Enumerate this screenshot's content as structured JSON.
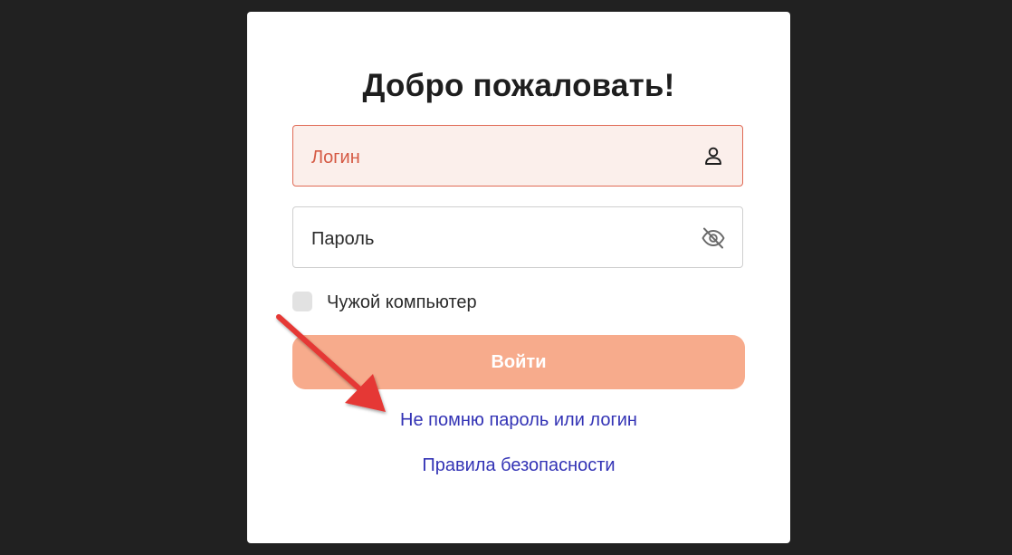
{
  "card": {
    "title": "Добро пожаловать!"
  },
  "login_field": {
    "label": "Логин",
    "icon": "user-icon",
    "state": "error",
    "accent_color": "#e06a55"
  },
  "password_field": {
    "label": "Пароль",
    "icon": "eye-off-icon"
  },
  "foreign_computer": {
    "label": "Чужой компьютер",
    "checked": false
  },
  "submit_button": {
    "label": "Войти",
    "color": "#f7ab8c"
  },
  "links": {
    "forgot": "Не помню пароль или логин",
    "security_rules": "Правила безопасности",
    "color": "#3333b5"
  },
  "annotation": {
    "icon": "red-arrow-icon",
    "color": "#e53935"
  }
}
